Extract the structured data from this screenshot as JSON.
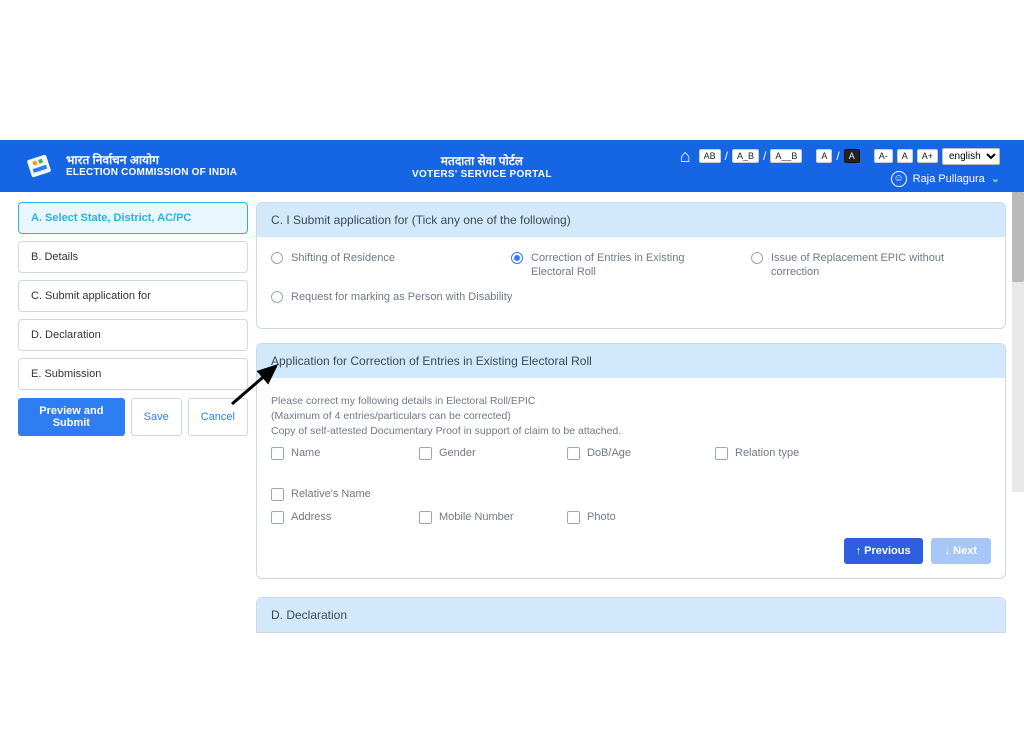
{
  "header": {
    "org_hi": "भारत निर्वाचन आयोग",
    "org_en": "ELECTION COMMISSION OF INDIA",
    "center_hi": "मतदाता सेवा पोर्टल",
    "center_en": "VOTERS' SERVICE PORTAL",
    "tool_ab": "AB",
    "tool_a_b": "A_B",
    "tool_a__b": "A__B",
    "tool_a1": "A",
    "tool_slash": "/",
    "tool_a_dark": "A",
    "tool_aminus": "A-",
    "tool_anorm": "A",
    "tool_aplus": "A+",
    "lang_value": "english",
    "user_name": "Raja Pullagura",
    "user_caret": "⌄"
  },
  "sidebar": {
    "steps": [
      "A. Select State, District, AC/PC",
      "B. Details",
      "C. Submit application for",
      "D. Declaration",
      "E. Submission"
    ],
    "preview": "Preview and Submit",
    "save": "Save",
    "cancel": "Cancel"
  },
  "sectionC": {
    "title": "C. I Submit application for (Tick any one of the following)",
    "opts": {
      "o1": "Shifting of Residence",
      "o2": "Correction of Entries in Existing Electoral Roll",
      "o3": "Issue of Replacement EPIC without correction",
      "o4": "Request for marking as Person with Disability"
    }
  },
  "correction": {
    "title": "Application for Correction of Entries in Existing Electoral Roll",
    "note1": "Please correct my following details in Electoral Roll/EPIC",
    "note2": "(Maximum of 4 entries/particulars can be corrected)",
    "note3": "Copy of self-attested Documentary Proof in support of claim to be attached.",
    "chk": {
      "name": "Name",
      "gender": "Gender",
      "dob": "DoB/Age",
      "reltype": "Relation type",
      "relname": "Relative's Name",
      "address": "Address",
      "mobile": "Mobile Number",
      "photo": "Photo"
    },
    "prev": "↑ Previous",
    "next": "↓ Next"
  },
  "sectionD": {
    "title": "D. Declaration"
  }
}
